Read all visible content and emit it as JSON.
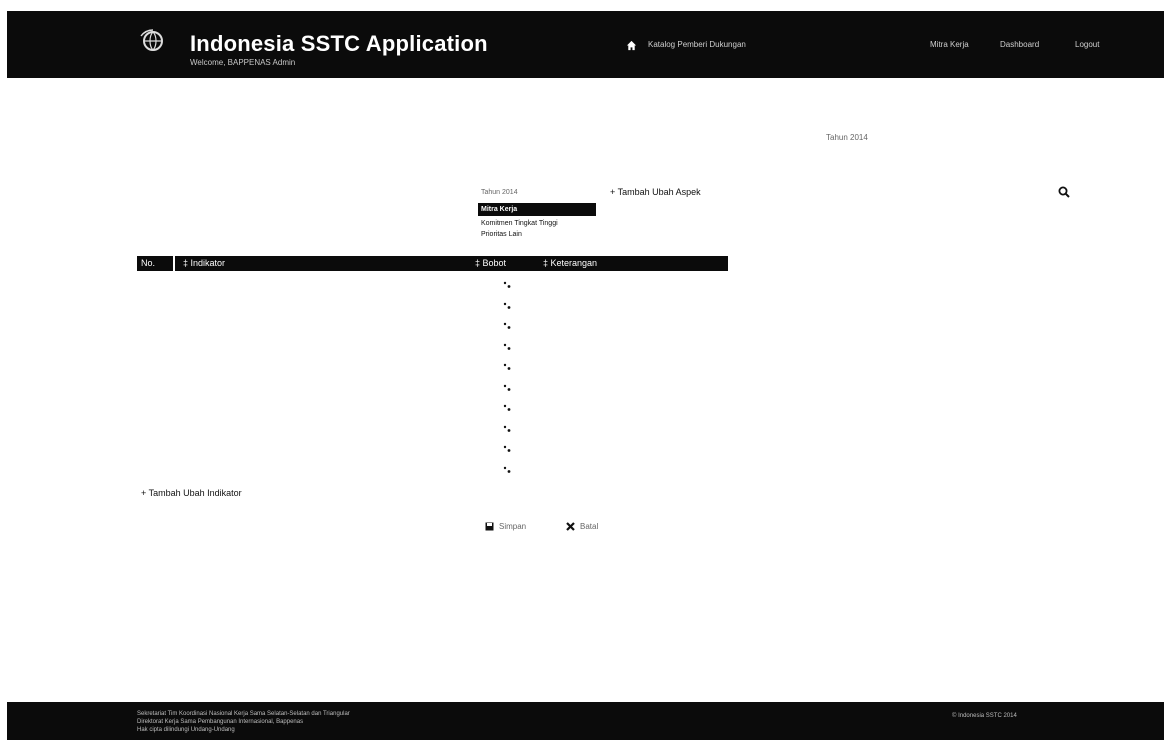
{
  "header": {
    "title": "Indonesia SSTC Application",
    "subtitle": "Welcome, BAPPENAS Admin",
    "nav": [
      {
        "label": "Katalog Pemberi Dukungan"
      },
      {
        "label": "Mitra Kerja"
      },
      {
        "label": "Dashboard"
      },
      {
        "label": "Logout"
      }
    ]
  },
  "page": {
    "small_right_text": "Tahun 2014"
  },
  "aspects": {
    "year_label": "Tahun 2014",
    "add_label": "+ Tambah Ubah Aspek",
    "items": [
      {
        "label": "Mitra Kerja",
        "active": true
      },
      {
        "label": "Komitmen Tingkat Tinggi",
        "active": false
      },
      {
        "label": "Prioritas Lain",
        "active": false
      }
    ]
  },
  "table": {
    "columns": {
      "no": "No.",
      "indikator": "‡ Indikator",
      "bobot": "‡ Bobot",
      "keterangan": "‡ Keterangan"
    },
    "row_count": 10
  },
  "actions": {
    "add_indicator": "+ Tambah Ubah Indikator",
    "save": "Simpan",
    "cancel": "Batal"
  },
  "footer": {
    "line1": "Sekretariat Tim Koordinasi Nasional Kerja Sama Selatan-Selatan dan Triangular",
    "line2": "Direktorat Kerja Sama Pembangunan Internasional, Bappenas",
    "line3": "Hak cipta dilindungi Undang-Undang",
    "right": "© Indonesia SSTC 2014"
  },
  "icons": {
    "logo": "globe-logo-icon",
    "home": "home-icon",
    "search": "search-icon",
    "save": "save-icon",
    "cancel": "close-icon",
    "row": "row-marker-icon"
  },
  "colors": {
    "bar": "#0b0b0b",
    "background": "#ffffff"
  }
}
